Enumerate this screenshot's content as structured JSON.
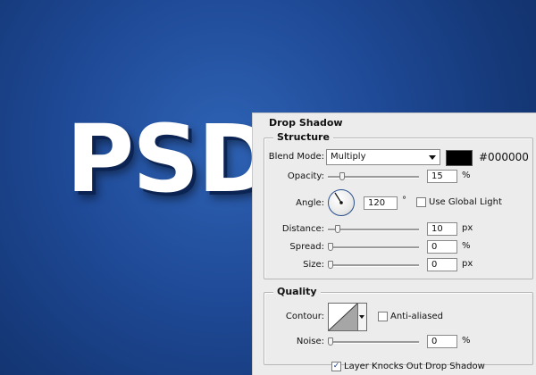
{
  "canvas": {
    "title": "PSD"
  },
  "panel": {
    "header": "Drop Shadow",
    "structure": {
      "title": "Structure",
      "blend_mode_label": "Blend Mode:",
      "blend_mode_value": "Multiply",
      "color_hex": "#000000",
      "color_label": "#000000",
      "opacity_label": "Opacity:",
      "opacity_value": "15",
      "opacity_unit": "%",
      "opacity_level": 0.15,
      "angle_label": "Angle:",
      "angle_value": "120",
      "angle_unit": "°",
      "use_global_light_label": "Use Global Light",
      "use_global_light_checked": false,
      "distance_label": "Distance:",
      "distance_value": "10",
      "distance_unit": "px",
      "spread_label": "Spread:",
      "spread_value": "0",
      "spread_unit": "%",
      "size_label": "Size:",
      "size_value": "0",
      "size_unit": "px"
    },
    "quality": {
      "title": "Quality",
      "contour_label": "Contour:",
      "anti_aliased_label": "Anti-aliased",
      "anti_aliased_checked": false,
      "noise_label": "Noise:",
      "noise_value": "0",
      "noise_unit": "%"
    },
    "layer_knocks_out_label": "Layer Knocks Out Drop Shadow",
    "layer_knocks_out_checked": true
  }
}
